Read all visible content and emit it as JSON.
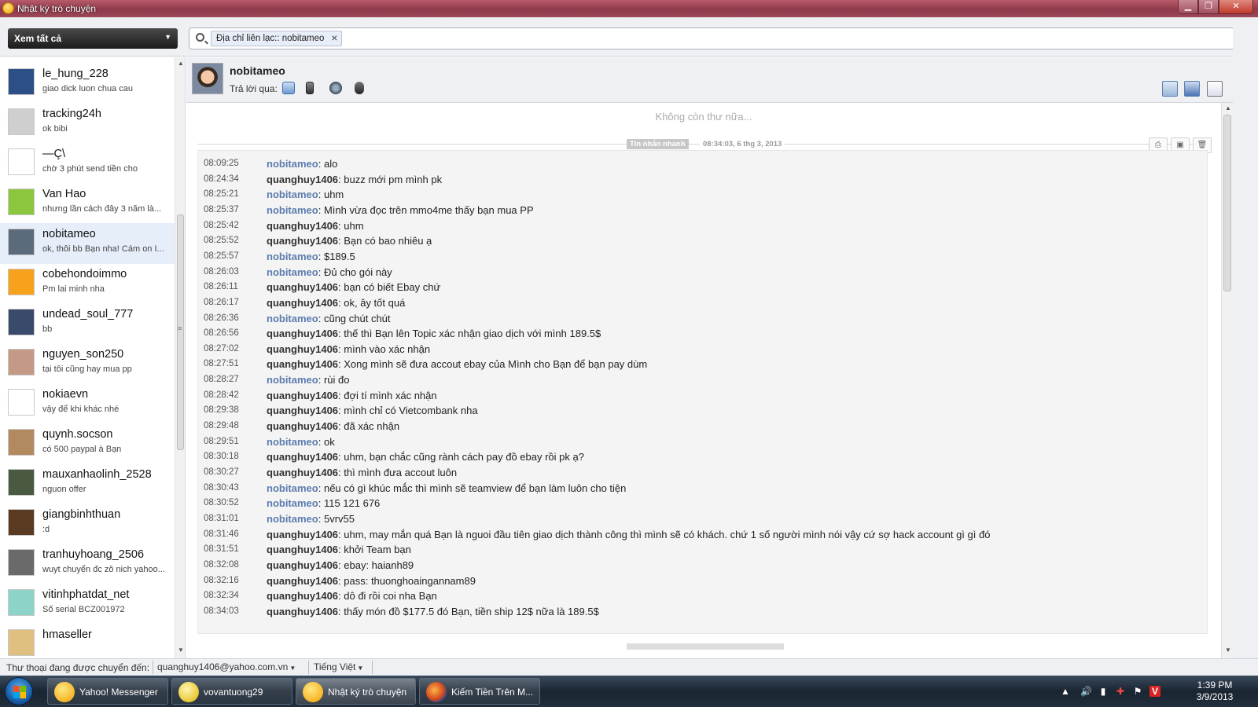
{
  "window": {
    "title": "Nhật ký trò chuyện"
  },
  "topbar": {
    "filter_label": "Xem tất cả",
    "search_token": "Địa chỉ liên lạc:: nobitameo"
  },
  "contacts": [
    {
      "name": "le_hung_228",
      "status": "giao dick luon chua cau",
      "avatar_color": "#2b4f86"
    },
    {
      "name": "tracking24h",
      "status": "ok bibi",
      "avatar_color": "#cfcfcf"
    },
    {
      "name": "—Ç\\",
      "status": "chờ 3 phút send tiền cho",
      "avatar_color": "#ffffff"
    },
    {
      "name": "Van Hao",
      "status": "nhưng lần cách đây 3 năm là...",
      "avatar_color": "#8cc63f"
    },
    {
      "name": "nobitameo",
      "status": "ok, thôi bb Bạn nha! Cám on I...",
      "avatar_color": "#5b6b7c"
    },
    {
      "name": "cobehondoimmo",
      "status": "Pm lai minh nha",
      "avatar_color": "#f7a21c"
    },
    {
      "name": "undead_soul_777",
      "status": "bb",
      "avatar_color": "#3a4a6a"
    },
    {
      "name": "nguyen_son250",
      "status": "tại tôi cũng hay mua pp",
      "avatar_color": "#c49a86"
    },
    {
      "name": "nokiaevn",
      "status": "vậy để khi khác nhé",
      "avatar_color": "#ffffff"
    },
    {
      "name": "quynh.socson",
      "status": "có 500 paypal à Bạn",
      "avatar_color": "#b38a60"
    },
    {
      "name": "mauxanhaolinh_2528",
      "status": "nguon offer",
      "avatar_color": "#4a5a40"
    },
    {
      "name": "giangbinhthuan",
      "status": ":d",
      "avatar_color": "#5a3a20"
    },
    {
      "name": "tranhuyhoang_2506",
      "status": "wuyt chuyển đc zô nich yahoo...",
      "avatar_color": "#6a6a6a"
    },
    {
      "name": "vitinhphatdat_net",
      "status": "Số serial BCZ001972",
      "avatar_color": "#8cd4c8"
    },
    {
      "name": "hmaseller",
      "status": "",
      "avatar_color": "#e0c080"
    }
  ],
  "conversation": {
    "contact_name": "nobitameo",
    "reply_label": "Trả lời qua:",
    "no_more": "Không còn thư nữa...",
    "im_badge": "Tin nhắn nhanh",
    "im_date": "08:34:03, 6 thg 3, 2013",
    "messages": [
      {
        "time": "08:09:25",
        "sender": "nobitameo",
        "from": "them",
        "text": ": alo"
      },
      {
        "time": "08:24:34",
        "sender": "quanghuy1406",
        "from": "me",
        "text": ": buzz mới pm mình pk"
      },
      {
        "time": "08:25:21",
        "sender": "nobitameo",
        "from": "them",
        "text": ": uhm"
      },
      {
        "time": "08:25:37",
        "sender": "nobitameo",
        "from": "them",
        "text": ": Mình vừa đọc trên mmo4me thấy bạn mua PP"
      },
      {
        "time": "08:25:42",
        "sender": "quanghuy1406",
        "from": "me",
        "text": ": uhm"
      },
      {
        "time": "08:25:52",
        "sender": "quanghuy1406",
        "from": "me",
        "text": ": Bạn có bao nhiêu ạ"
      },
      {
        "time": "08:25:57",
        "sender": "nobitameo",
        "from": "them",
        "text": ": $189.5"
      },
      {
        "time": "08:26:03",
        "sender": "nobitameo",
        "from": "them",
        "text": ": Đủ cho gói này"
      },
      {
        "time": "08:26:11",
        "sender": "quanghuy1406",
        "from": "me",
        "text": ": bạn có biết Ebay chứ"
      },
      {
        "time": "08:26:17",
        "sender": "quanghuy1406",
        "from": "me",
        "text": ": ok, ây tốt quá"
      },
      {
        "time": "08:26:36",
        "sender": "nobitameo",
        "from": "them",
        "text": ": cũng chút chút"
      },
      {
        "time": "08:26:56",
        "sender": "quanghuy1406",
        "from": "me",
        "text": ": thế thì Bạn lên Topic xác nhận giao dịch với mình 189.5$"
      },
      {
        "time": "08:27:02",
        "sender": "quanghuy1406",
        "from": "me",
        "text": ": mình vào xác nhận"
      },
      {
        "time": "08:27:51",
        "sender": "quanghuy1406",
        "from": "me",
        "text": ": Xong mình sẽ đưa accout ebay của Mình cho Bạn để bạn pay dùm"
      },
      {
        "time": "08:28:27",
        "sender": "nobitameo",
        "from": "them",
        "text": ": rùi đo"
      },
      {
        "time": "08:28:42",
        "sender": "quanghuy1406",
        "from": "me",
        "text": ": đợi tí mình xác nhận"
      },
      {
        "time": "08:29:38",
        "sender": "quanghuy1406",
        "from": "me",
        "text": ": mình chỉ có Vietcombank nha"
      },
      {
        "time": "08:29:48",
        "sender": "quanghuy1406",
        "from": "me",
        "text": ": đã xác nhận"
      },
      {
        "time": "08:29:51",
        "sender": "nobitameo",
        "from": "them",
        "text": ": ok"
      },
      {
        "time": "08:30:18",
        "sender": "quanghuy1406",
        "from": "me",
        "text": ": uhm, bạn chắc cũng rành cách pay đồ ebay rồi pk ạ?"
      },
      {
        "time": "08:30:27",
        "sender": "quanghuy1406",
        "from": "me",
        "text": ": thì mình đưa accout luôn"
      },
      {
        "time": "08:30:43",
        "sender": "nobitameo",
        "from": "them",
        "text": ": nếu có gì khúc mắc thì mình sẽ teamview để bạn làm luôn cho tiện"
      },
      {
        "time": "08:30:52",
        "sender": "nobitameo",
        "from": "them",
        "text": ": 115 121 676"
      },
      {
        "time": "08:31:01",
        "sender": "nobitameo",
        "from": "them",
        "text": ": 5vrv55"
      },
      {
        "time": "08:31:46",
        "sender": "quanghuy1406",
        "from": "me",
        "text": ": uhm, may mắn quá Bạn là nguoi đầu tiên giao dịch thành công thì mình sẽ có khách. chứ 1 số người mình nói vậy cứ sợ hack account gì gì đó"
      },
      {
        "time": "08:31:51",
        "sender": "quanghuy1406",
        "from": "me",
        "text": ": khởi Team bạn"
      },
      {
        "time": "08:32:08",
        "sender": "quanghuy1406",
        "from": "me",
        "text": ": ebay: haianh89"
      },
      {
        "time": "08:32:16",
        "sender": "quanghuy1406",
        "from": "me",
        "text": ": pass: thuonghoaingannam89"
      },
      {
        "time": "08:32:34",
        "sender": "quanghuy1406",
        "from": "me",
        "text": ": dô đi rồi coi nha Bạn"
      },
      {
        "time": "08:34:03",
        "sender": "quanghuy1406",
        "from": "me",
        "text": ": thấy món đồ $177.5 đó Bạn, tiền ship 12$ nữa là 189.5$"
      }
    ]
  },
  "statusbar": {
    "forward_label": "Thư thoại đang được chuyển đến:",
    "forward_email": "quanghuy1406@yahoo.com.vn",
    "language": "Tiếng Việt"
  },
  "taskbar": {
    "tasks": [
      {
        "label": "Yahoo! Messenger",
        "icon": "yahoo-messenger-icon"
      },
      {
        "label": "vovantuong29",
        "icon": "chat-bubble-icon"
      },
      {
        "label": "Nhật ký trò chuyện",
        "icon": "yahoo-messenger-icon"
      },
      {
        "label": "Kiếm Tiền Trên M...",
        "icon": "firefox-icon"
      }
    ],
    "time": "1:39 PM",
    "date": "3/9/2013"
  },
  "colors": {
    "them": "#5b7cae",
    "me": "#333333",
    "selected_row": "#e6eefa",
    "titlebar": "#9e4858"
  }
}
